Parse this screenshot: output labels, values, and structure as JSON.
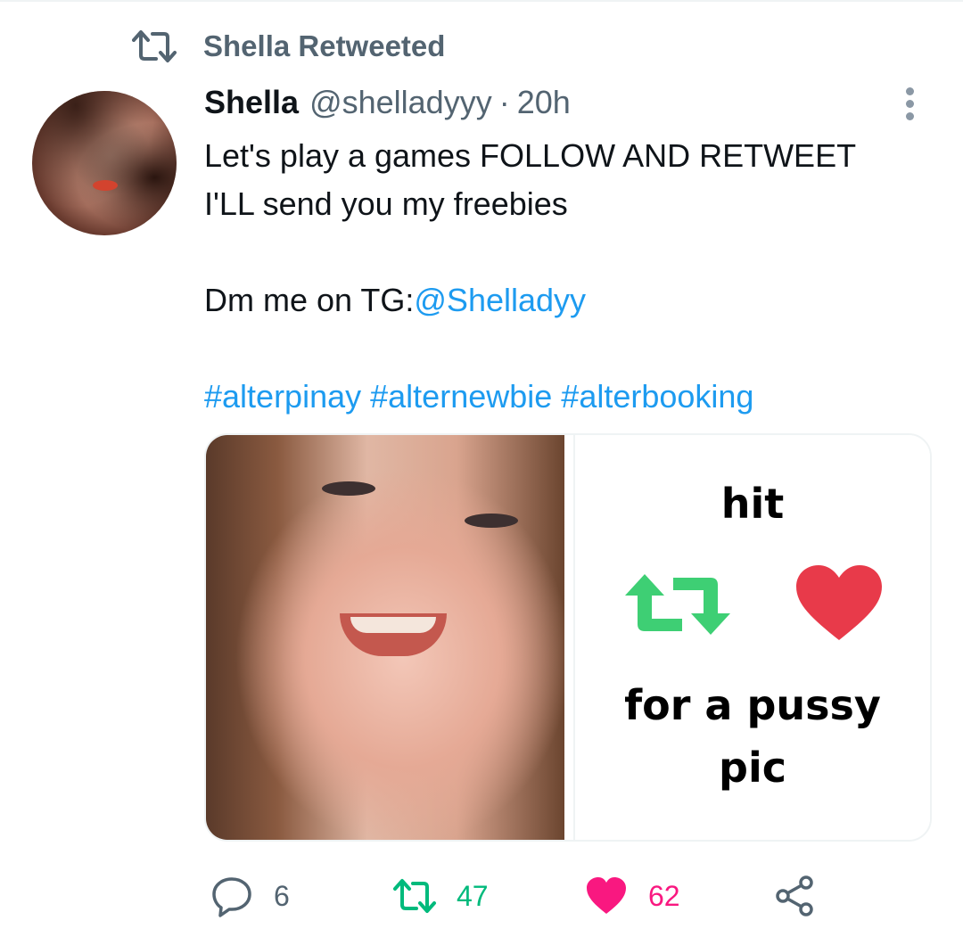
{
  "social_context": {
    "label": "Shella Retweeted",
    "icon": "retweet-icon"
  },
  "author": {
    "name": "Shella",
    "handle": "@shelladyyy",
    "separator": "·",
    "time": "20h"
  },
  "tweet": {
    "line1": "Let's play a games FOLLOW AND RETWEET",
    "line2": "I'LL send you my freebies",
    "dm_prefix": "Dm me on TG:",
    "dm_mention": "@Shelladyy",
    "hashtags": [
      "#alterpinay",
      "#alternewbie",
      "#alterbooking"
    ]
  },
  "media_card": {
    "top_text": "hit",
    "caption_line1": "for a pussy",
    "caption_line2": "pic",
    "retweet_color": "#3ecf74",
    "heart_color": "#e83a4a"
  },
  "actions": {
    "reply_count": "6",
    "retweet_count": "47",
    "like_count": "62",
    "retweet_color": "#00ba7c",
    "like_color": "#f91880"
  },
  "colors": {
    "link": "#1d9bf0",
    "secondary_text": "#536471",
    "primary_text": "#0f1419"
  }
}
